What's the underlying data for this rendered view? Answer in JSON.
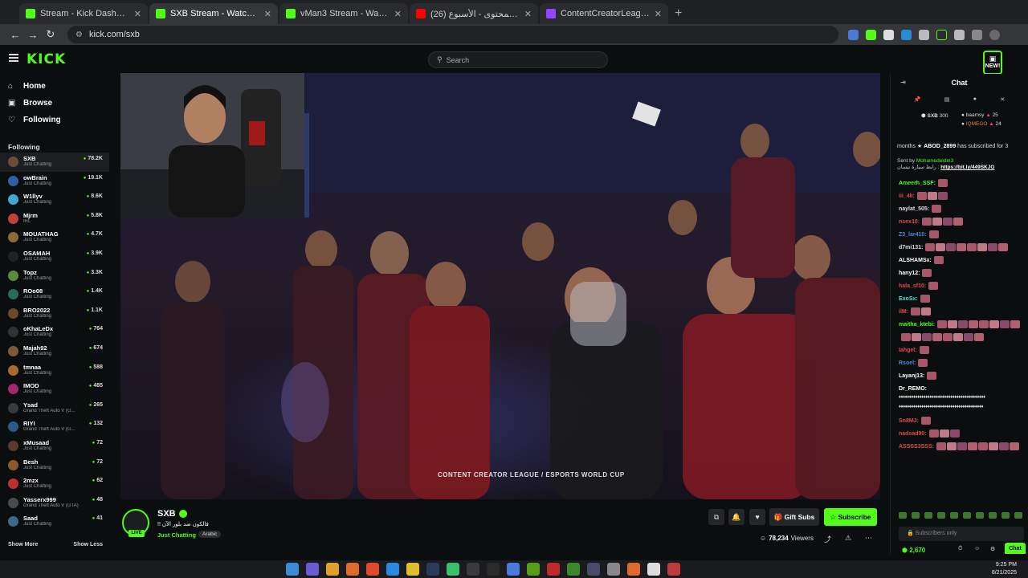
{
  "browser": {
    "tabs": [
      {
        "title": "Stream - Kick Dashboard",
        "color": "#53fc18",
        "active": false
      },
      {
        "title": "SXB Stream - Watch Live on Kick",
        "color": "#53fc18",
        "active": true
      },
      {
        "title": "vMan3 Stream - Watch Live on Kick",
        "color": "#53fc18",
        "active": false
      },
      {
        "title": "(26) دوري صناع المحتوى - الأسبوع",
        "color": "#ff0000",
        "active": false
      },
      {
        "title": "ContentCreatorLeague - Twitch",
        "color": "#9146ff",
        "active": false
      }
    ],
    "new_tab": "+",
    "url": "kick.com/sxb"
  },
  "header": {
    "logo": "KICK",
    "search_placeholder": "Search",
    "new_badge": "NEW!"
  },
  "sidebar": {
    "nav": [
      {
        "label": "Home",
        "icon": "home-icon",
        "glyph": "⌂"
      },
      {
        "label": "Browse",
        "icon": "browse-icon",
        "glyph": "▣"
      },
      {
        "label": "Following",
        "icon": "heart-icon",
        "glyph": "♡"
      }
    ],
    "section_title": "Following",
    "following": [
      {
        "name": "SXB",
        "category": "Just Chatting",
        "viewers": "78.2K",
        "color": "#6b4d3a"
      },
      {
        "name": "owBrain",
        "category": "Just Chatting",
        "viewers": "19.1K",
        "color": "#2f5fa8"
      },
      {
        "name": "W1llyv",
        "category": "Just Chatting",
        "viewers": "8.6K",
        "color": "#3fa7d6"
      },
      {
        "name": "Mjrm",
        "category": "IRL",
        "viewers": "5.8K",
        "color": "#c04040"
      },
      {
        "name": "MOUATHAG",
        "category": "Just Chatting",
        "viewers": "4.7K",
        "color": "#8a6a3a"
      },
      {
        "name": "OSAMAH",
        "category": "Just Chatting",
        "viewers": "3.9K",
        "color": "#222222"
      },
      {
        "name": "Topz",
        "category": "Just Chatting",
        "viewers": "3.3K",
        "color": "#5a8a3a"
      },
      {
        "name": "ROo08",
        "category": "Just Chatting",
        "viewers": "1.4K",
        "color": "#2a6a5a"
      },
      {
        "name": "BRO2022",
        "category": "Just Chatting",
        "viewers": "1.1K",
        "color": "#6a4a2a"
      },
      {
        "name": "oKhaLeDx",
        "category": "Just Chatting",
        "viewers": "764",
        "color": "#333333"
      },
      {
        "name": "Majah92",
        "category": "Just Chatting",
        "viewers": "674",
        "color": "#7a5a3a"
      },
      {
        "name": "tmnaa",
        "category": "Just Chatting",
        "viewers": "588",
        "color": "#aa6a2a"
      },
      {
        "name": "IMOD",
        "category": "Just Chatting",
        "viewers": "485",
        "color": "#a02a6a"
      },
      {
        "name": "Ysad",
        "category": "Grand Theft Auto V (G...",
        "viewers": "265",
        "color": "#3a3a3a"
      },
      {
        "name": "RIYI",
        "category": "Grand Theft Auto V (G...",
        "viewers": "132",
        "color": "#2a5a8a"
      },
      {
        "name": "xMusaad",
        "category": "Just Chatting",
        "viewers": "72",
        "color": "#5a3a2a"
      },
      {
        "name": "Besh",
        "category": "Just Chatting",
        "viewers": "72",
        "color": "#8a5a2a"
      },
      {
        "name": "2mzx",
        "category": "Just Chatting",
        "viewers": "62",
        "color": "#c03030"
      },
      {
        "name": "Yasserx999",
        "category": "Grand Theft Auto V (GTA)",
        "viewers": "48",
        "color": "#4a4a4a"
      },
      {
        "name": "Saad",
        "category": "Just Chatting",
        "viewers": "41",
        "color": "#3a6a8a"
      }
    ],
    "show_more": "Show More",
    "show_less": "Show Less"
  },
  "stream": {
    "channel": "SXB",
    "title": "!! فالكون ضد بلور الآن",
    "category": "Just Chatting",
    "language": "Arabic",
    "live_label": "LIVE",
    "gift_label": "Gift Subs",
    "subscribe_label": "Subscribe",
    "viewers": "78,234",
    "viewers_label": "Viewers",
    "overlay_text": "CONTENT CREATOR LEAGUE / ESPORTS WORLD CUP"
  },
  "chat": {
    "title": "Chat",
    "leaderboard": [
      {
        "name": "SXB",
        "value": "300"
      },
      {
        "name": "baamsy",
        "value": "25"
      },
      {
        "name": "IQMEGO",
        "value": "24"
      }
    ],
    "sub_notice_user": "ABOD_2899",
    "sub_notice_prefix": "months",
    "sub_notice_text": "has subscribed for 3",
    "pinned_by": "Sent by",
    "pinned_user": "Mohamedeldin3",
    "pinned_text": "رابط سيارة نيسان :",
    "pinned_link": "https://bit.ly/449SKJG",
    "messages": [
      {
        "user": "Ameerh_SSF:",
        "color": "#53fc18",
        "emotes": 1
      },
      {
        "user": "iii_4li:",
        "color": "#e04a4a",
        "emotes": 3
      },
      {
        "user": "naylat_505:",
        "color": "#ddd",
        "emotes": 1
      },
      {
        "user": "nsex10:",
        "color": "#e04a4a",
        "emotes": 4
      },
      {
        "user": "Z3_lar410:",
        "color": "#4a8ae0",
        "emotes": 1
      },
      {
        "user": "d7mi131:",
        "color": "#ddd",
        "emotes": 8
      },
      {
        "user": "ALSHAMSx:",
        "color": "#fff",
        "emotes": 1
      },
      {
        "user": "hany12:",
        "color": "#fff",
        "emotes": 1
      },
      {
        "user": "hala_sf10:",
        "color": "#e04a4a",
        "emotes": 1
      },
      {
        "user": "ExoSx:",
        "color": "#4ae0e0",
        "emotes": 1
      },
      {
        "user": "ilM:",
        "color": "#e04a4a",
        "emotes": 2
      },
      {
        "user": "maitha_ktebi:",
        "color": "#53fc18",
        "emotes": 8
      },
      {
        "user": "",
        "color": "#fff",
        "emotes": 8
      },
      {
        "user": "Iahgel:",
        "color": "#e04a4a",
        "emotes": 1
      },
      {
        "user": "Rsoel:",
        "color": "#4a8ae0",
        "emotes": 1
      },
      {
        "user": "Layanj13:",
        "color": "#fff",
        "emotes": 1
      },
      {
        "user": "Dr_REMO:",
        "color": "#fff",
        "emotes": 0
      }
    ],
    "dots_line_1": "♦♦♦♦♦♦♦♦♦♦♦♦♦♦♦♦♦♦♦♦♦♦♦♦♦♦♦♦♦♦♦♦♦♦♦♦♦♦♦♦♦♦",
    "dots_line_2": "♦♦♦♦♦♦♦♦♦♦♦♦♦♦♦♦♦♦♦♦♦♦♦♦♦♦♦♦♦♦♦♦♦♦♦♦♦♦♦♦♦",
    "messages2": [
      {
        "user": "Sn8MJ:",
        "color": "#e04a4a",
        "emotes": 1
      },
      {
        "user": "nadsad90:",
        "color": "#e04a4a",
        "emotes": 3
      },
      {
        "user": "ASSSS3SSS:",
        "color": "#e04a4a",
        "emotes": 8
      }
    ],
    "subscribers_only": "Subscribers only",
    "points": "2,670",
    "chat_button": "Chat"
  },
  "taskbar": {
    "time": "9:25 PM",
    "date": "8/21/2025"
  }
}
